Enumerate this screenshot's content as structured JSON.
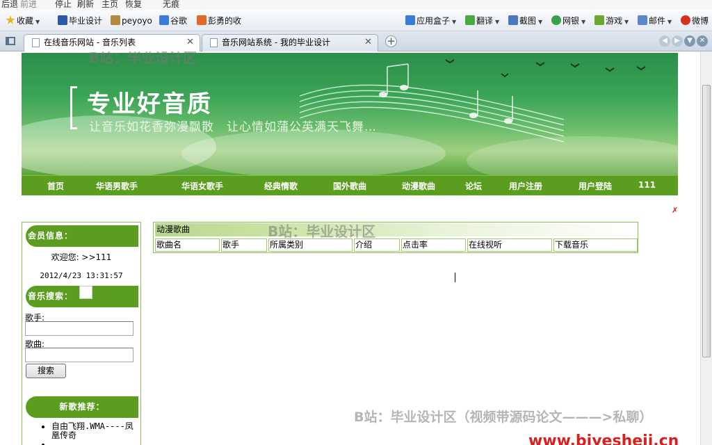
{
  "browser": {
    "menu": [
      "后退",
      "前进",
      "停止",
      "刷新",
      "主页",
      "恢复",
      "无痕"
    ],
    "favorites": [
      {
        "label": "收藏",
        "icon": "star-icon",
        "color": "#e8b422",
        "caret": true
      },
      {
        "label": "毕业设计",
        "icon": "bookmark-icon",
        "color": "#2a5aa8",
        "caret": false
      },
      {
        "label": "peyoyo",
        "icon": "page-icon",
        "color": "#b48a3c",
        "caret": false
      },
      {
        "label": "谷歌",
        "icon": "google-icon",
        "color": "#3b7be0",
        "caret": false
      },
      {
        "label": "彭勇的收",
        "icon": "page-icon",
        "color": "#e06a2a",
        "caret": false
      }
    ],
    "toolbar_right": [
      {
        "label": "应用盒子",
        "icon": "box-icon",
        "color": "#3a7bd5",
        "caret": true
      },
      {
        "label": "翻译",
        "icon": "translate-icon",
        "color": "#49a942",
        "caret": true
      },
      {
        "label": "截图",
        "icon": "screenshot-icon",
        "color": "#4a78c0",
        "caret": true
      },
      {
        "label": "网银",
        "icon": "bank-icon",
        "color": "#3aa04a",
        "caret": true
      },
      {
        "label": "游戏",
        "icon": "game-icon",
        "color": "#6aa830",
        "caret": true
      },
      {
        "label": "邮件",
        "icon": "mail-icon",
        "color": "#5a88c8",
        "caret": true
      },
      {
        "label": "微博",
        "icon": "weibo-icon",
        "color": "#d8321e",
        "caret": false
      }
    ],
    "tabs": [
      {
        "title": "在线音乐网站 - 音乐列表",
        "active": true
      },
      {
        "title": "音乐网站系统 - 我的毕业设计",
        "active": false
      }
    ],
    "new_tab": "+"
  },
  "site": {
    "banner": {
      "slogan": "专业好音质",
      "subslogan": "让音乐如花香弥漫飘散　让心情如蒲公英满天飞舞…"
    },
    "nav": [
      "首页",
      "华语男歌手",
      "华语女歌手",
      "经典情歌",
      "国外歌曲",
      "动漫歌曲",
      "论坛",
      "用户注册",
      "用户登陆",
      "111"
    ],
    "sidebar": {
      "member_title": "会员信息：",
      "welcome": "欢迎您: >>111",
      "datetime": "2012/4/23 13:31:57",
      "search_title": "音乐搜索：",
      "singer_label": "歌手:",
      "singer_value": "",
      "song_label": "歌曲:",
      "song_value": "",
      "search_button": "搜索",
      "new_title": "新歌推荐：",
      "new_songs": [
        "自由飞翔.WMA----凤凰传奇"
      ]
    },
    "main": {
      "category": "动漫歌曲",
      "columns": [
        "歌曲名",
        "歌手",
        "所属类别",
        "介绍",
        "点击率",
        "在线视听",
        "下载音乐"
      ]
    }
  },
  "overlay": {
    "watermark_1": "B站：毕业设计区",
    "watermark_2": "B站：毕业设计区",
    "watermark_3": "B站：毕业设计区（视频带源码论文———>私聊）",
    "url": "www.biyesheji.cn"
  },
  "colors": {
    "nav_green": "#5b9e1f",
    "border_green": "#8cbf55",
    "link_red": "#d82020"
  }
}
